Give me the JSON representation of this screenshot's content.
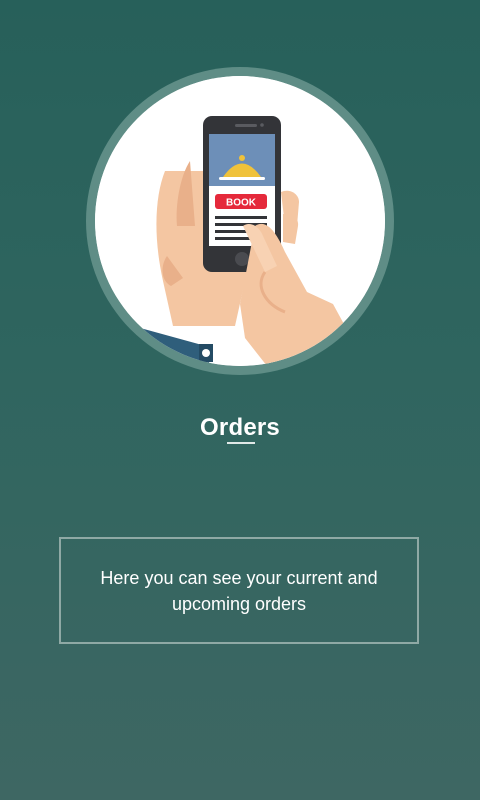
{
  "screen": {
    "title": "Orders",
    "description": "Here you can see your current and upcoming orders"
  },
  "illustration": {
    "button_label": "BOOK",
    "icon": "phone-booking-illustration"
  },
  "colors": {
    "background_top": "#27605a",
    "background_bottom": "#3e6763",
    "ring": "#5f8d86",
    "book_button": "#e5293b"
  }
}
